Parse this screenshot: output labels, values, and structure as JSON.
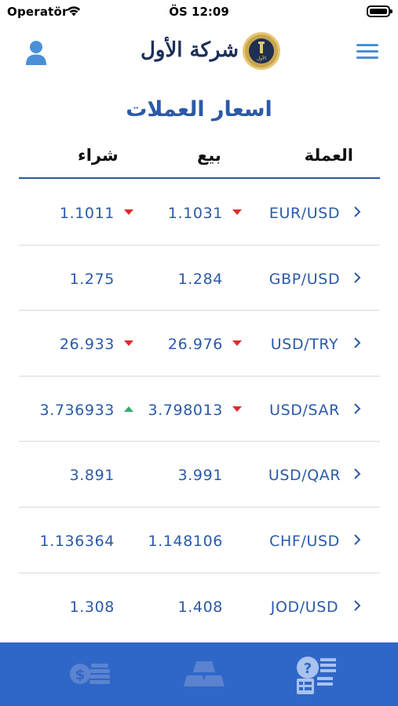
{
  "status_bar": {
    "carrier": "Operatör",
    "time": "ÖS 12:09"
  },
  "header": {
    "company_name": "شركة الأول",
    "badge_text": "الأول"
  },
  "page_title": "اسعار العملات",
  "table": {
    "columns": {
      "currency": "العملة",
      "sell": "بيع",
      "buy": "شراء"
    },
    "rows": [
      {
        "pair": "EUR/USD",
        "sell": "1.1031",
        "sell_trend": "down",
        "buy": "1.1011",
        "buy_trend": "down"
      },
      {
        "pair": "GBP/USD",
        "sell": "1.284",
        "sell_trend": "none",
        "buy": "1.275",
        "buy_trend": "none"
      },
      {
        "pair": "USD/TRY",
        "sell": "26.976",
        "sell_trend": "down",
        "buy": "26.933",
        "buy_trend": "down"
      },
      {
        "pair": "USD/SAR",
        "sell": "3.798013",
        "sell_trend": "down",
        "buy": "3.736933",
        "buy_trend": "up"
      },
      {
        "pair": "USD/QAR",
        "sell": "3.991",
        "sell_trend": "none",
        "buy": "3.891",
        "buy_trend": "none"
      },
      {
        "pair": "CHF/USD",
        "sell": "1.148106",
        "sell_trend": "none",
        "buy": "1.136364",
        "buy_trend": "none"
      },
      {
        "pair": "JOD/USD",
        "sell": "1.408",
        "sell_trend": "none",
        "buy": "1.308",
        "buy_trend": "none"
      }
    ]
  },
  "tab_bar": {
    "tabs": [
      {
        "icon": "coins-dollar-icon",
        "active": false
      },
      {
        "icon": "gold-bars-icon",
        "active": false
      },
      {
        "icon": "currency-rates-icon",
        "active": true
      }
    ]
  },
  "colors": {
    "accent": "#2b5aa8",
    "tab_bar": "#2f67c9",
    "trend_down": "#e02b2b",
    "trend_up": "#2fae6b",
    "menu": "#4a8fd6"
  }
}
